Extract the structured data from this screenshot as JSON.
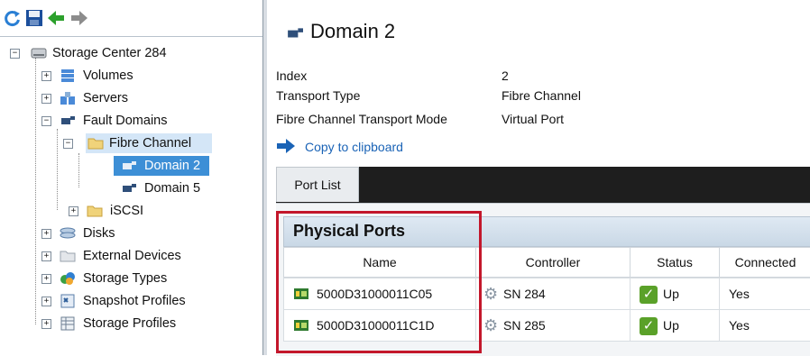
{
  "toolbar": {
    "buttons": [
      {
        "name": "refresh-icon",
        "color": "#2a7fd4"
      },
      {
        "name": "save-icon",
        "color": "#1c4f9c"
      },
      {
        "name": "back-arrow-icon",
        "color": "#2ca02c"
      },
      {
        "name": "forward-arrow-icon",
        "color": "#8c8c8c"
      }
    ]
  },
  "tree": {
    "root": "Storage Center 284",
    "items": [
      {
        "label": "Volumes"
      },
      {
        "label": "Servers"
      },
      {
        "label": "Fault Domains"
      },
      {
        "label": "Fibre Channel"
      },
      {
        "label": "Domain 2"
      },
      {
        "label": "Domain 5"
      },
      {
        "label": "iSCSI"
      },
      {
        "label": "Disks"
      },
      {
        "label": "External Devices"
      },
      {
        "label": "Storage Types"
      },
      {
        "label": "Snapshot Profiles"
      },
      {
        "label": "Storage Profiles"
      }
    ]
  },
  "detail": {
    "title": "Domain 2",
    "properties": [
      {
        "key": "Index",
        "value": "2"
      },
      {
        "key": "Transport Type",
        "value": "Fibre Channel"
      },
      {
        "key": "Fibre Channel Transport Mode",
        "value": "Virtual Port"
      }
    ],
    "copy_label": "Copy to clipboard",
    "tab": "Port List",
    "section_title": "Physical Ports",
    "columns": [
      "Name",
      "Controller",
      "Status",
      "Connected"
    ],
    "rows": [
      {
        "name": "5000D31000011C05",
        "controller": "SN 284",
        "status": "Up",
        "connected": "Yes"
      },
      {
        "name": "5000D31000011C1D",
        "controller": "SN 285",
        "status": "Up",
        "connected": "Yes"
      }
    ]
  },
  "colors": {
    "selection": "#3d8fd6",
    "highlight_box": "#c3172b",
    "status_up": "#5aa129"
  }
}
